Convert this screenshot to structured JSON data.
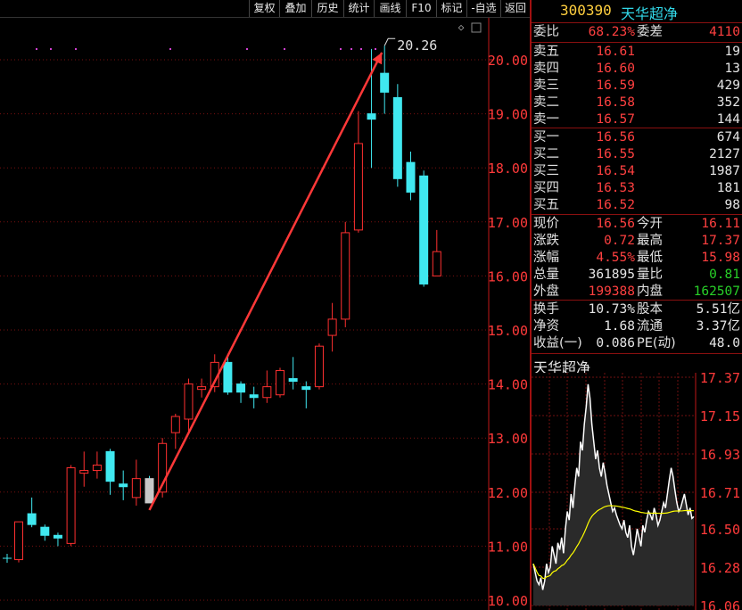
{
  "toolbar": {
    "buttons": [
      "复权",
      "叠加",
      "历史",
      "统计",
      "画线",
      "F10",
      "标记",
      "-自选",
      "返回"
    ]
  },
  "kline": {
    "y_axis_labels": [
      "20.00",
      "19.00",
      "18.00",
      "17.00",
      "16.00",
      "15.00",
      "14.00",
      "13.00",
      "12.00",
      "11.00",
      "10.00"
    ],
    "annotation_label": "20.26",
    "candles": [
      {
        "o": 10.75,
        "c": 11.45,
        "h": 11.45,
        "l": 10.7,
        "up": true
      },
      {
        "o": 11.6,
        "c": 11.4,
        "h": 11.9,
        "l": 11.35,
        "up": false
      },
      {
        "o": 11.35,
        "c": 11.2,
        "h": 11.4,
        "l": 11.1,
        "up": false
      },
      {
        "o": 11.2,
        "c": 11.15,
        "h": 11.25,
        "l": 11.0,
        "up": false
      },
      {
        "o": 11.05,
        "c": 12.45,
        "h": 12.5,
        "l": 11.0,
        "up": true
      },
      {
        "o": 12.35,
        "c": 12.4,
        "h": 12.75,
        "l": 12.1,
        "up": true
      },
      {
        "o": 12.4,
        "c": 12.5,
        "h": 12.75,
        "l": 12.25,
        "up": true
      },
      {
        "o": 12.75,
        "c": 12.2,
        "h": 12.8,
        "l": 11.95,
        "up": false
      },
      {
        "o": 12.15,
        "c": 12.1,
        "h": 12.4,
        "l": 11.85,
        "up": false
      },
      {
        "o": 11.9,
        "c": 12.25,
        "h": 12.6,
        "l": 11.75,
        "up": true
      },
      {
        "o": 12.25,
        "c": 11.8,
        "h": 12.3,
        "l": 11.8,
        "up": false
      },
      {
        "o": 12.0,
        "c": 12.9,
        "h": 13.0,
        "l": 11.9,
        "up": true
      },
      {
        "o": 13.1,
        "c": 13.4,
        "h": 13.45,
        "l": 12.8,
        "up": true
      },
      {
        "o": 13.35,
        "c": 14.0,
        "h": 14.1,
        "l": 13.1,
        "up": true
      },
      {
        "o": 13.9,
        "c": 13.95,
        "h": 14.1,
        "l": 13.75,
        "up": true
      },
      {
        "o": 13.95,
        "c": 14.4,
        "h": 14.55,
        "l": 13.85,
        "up": true
      },
      {
        "o": 14.4,
        "c": 13.85,
        "h": 14.5,
        "l": 13.8,
        "up": false
      },
      {
        "o": 14.0,
        "c": 13.85,
        "h": 14.05,
        "l": 13.65,
        "up": false
      },
      {
        "o": 13.8,
        "c": 13.75,
        "h": 13.95,
        "l": 13.55,
        "up": false
      },
      {
        "o": 13.75,
        "c": 13.95,
        "h": 14.25,
        "l": 13.65,
        "up": true
      },
      {
        "o": 13.8,
        "c": 14.25,
        "h": 14.3,
        "l": 13.75,
        "up": true
      },
      {
        "o": 14.1,
        "c": 14.05,
        "h": 14.5,
        "l": 13.9,
        "up": false
      },
      {
        "o": 13.95,
        "c": 13.9,
        "h": 14.05,
        "l": 13.55,
        "up": false
      },
      {
        "o": 13.95,
        "c": 14.7,
        "h": 14.75,
        "l": 13.9,
        "up": true
      },
      {
        "o": 14.9,
        "c": 15.2,
        "h": 15.5,
        "l": 14.6,
        "up": true
      },
      {
        "o": 15.2,
        "c": 16.8,
        "h": 17.0,
        "l": 15.05,
        "up": true
      },
      {
        "o": 16.85,
        "c": 18.45,
        "h": 19.05,
        "l": 16.8,
        "up": true
      },
      {
        "o": 19.0,
        "c": 18.9,
        "h": 20.2,
        "l": 18.0,
        "up": false
      },
      {
        "o": 19.75,
        "c": 19.4,
        "h": 20.26,
        "l": 19.0,
        "up": false
      },
      {
        "o": 19.3,
        "c": 17.8,
        "h": 19.55,
        "l": 17.65,
        "up": false
      },
      {
        "o": 18.1,
        "c": 17.55,
        "h": 18.3,
        "l": 17.4,
        "up": false
      },
      {
        "o": 17.85,
        "c": 15.85,
        "h": 17.95,
        "l": 15.8,
        "up": false
      },
      {
        "o": 16.0,
        "c": 16.45,
        "h": 16.85,
        "l": 16.0,
        "up": true
      }
    ]
  },
  "quote": {
    "code": "300390",
    "name": "天华超净",
    "weibi_label": "委比",
    "weibi_value": "68.23%",
    "weicha_label": "委差",
    "weicha_value": "4110",
    "asks": [
      {
        "label": "卖五",
        "price": "16.61",
        "vol": "19"
      },
      {
        "label": "卖四",
        "price": "16.60",
        "vol": "13"
      },
      {
        "label": "卖三",
        "price": "16.59",
        "vol": "429"
      },
      {
        "label": "卖二",
        "price": "16.58",
        "vol": "352"
      },
      {
        "label": "卖一",
        "price": "16.57",
        "vol": "144"
      }
    ],
    "bids": [
      {
        "label": "买一",
        "price": "16.56",
        "vol": "674"
      },
      {
        "label": "买二",
        "price": "16.55",
        "vol": "2127"
      },
      {
        "label": "买三",
        "price": "16.54",
        "vol": "1987"
      },
      {
        "label": "买四",
        "price": "16.53",
        "vol": "181"
      },
      {
        "label": "买五",
        "price": "16.52",
        "vol": "98"
      }
    ],
    "stats": [
      {
        "l1": "现价",
        "v1": "16.56",
        "c1": "red",
        "l2": "今开",
        "v2": "16.11",
        "c2": "red"
      },
      {
        "l1": "涨跌",
        "v1": "0.72",
        "c1": "red",
        "l2": "最高",
        "v2": "17.37",
        "c2": "red"
      },
      {
        "l1": "涨幅",
        "v1": "4.55%",
        "c1": "red",
        "l2": "最低",
        "v2": "15.98",
        "c2": "red"
      },
      {
        "l1": "总量",
        "v1": "361895",
        "c1": "white",
        "l2": "量比",
        "v2": "0.81",
        "c2": "green"
      },
      {
        "l1": "外盘",
        "v1": "199388",
        "c1": "red",
        "l2": "内盘",
        "v2": "162507",
        "c2": "green"
      }
    ],
    "fund": [
      {
        "l1": "换手",
        "v1": "10.73%",
        "l2": "股本",
        "v2": "5.51亿"
      },
      {
        "l1": "净资",
        "v1": "1.68",
        "l2": "流通",
        "v2": "3.37亿"
      },
      {
        "l1": "收益(一)",
        "v1": "0.086",
        "l2": "PE(动)",
        "v2": "48.0"
      }
    ]
  },
  "mini": {
    "title": "天华超净",
    "y_labels": [
      "17.37",
      "17.15",
      "16.93",
      "16.71",
      "16.50",
      "16.28",
      "16.06"
    ]
  },
  "colors": {
    "up": "#ff3030",
    "down": "#40e8f0",
    "axis": "#c01818",
    "grid": "#7a1010",
    "price": "#ffffff",
    "avg": "#ffff00"
  }
}
